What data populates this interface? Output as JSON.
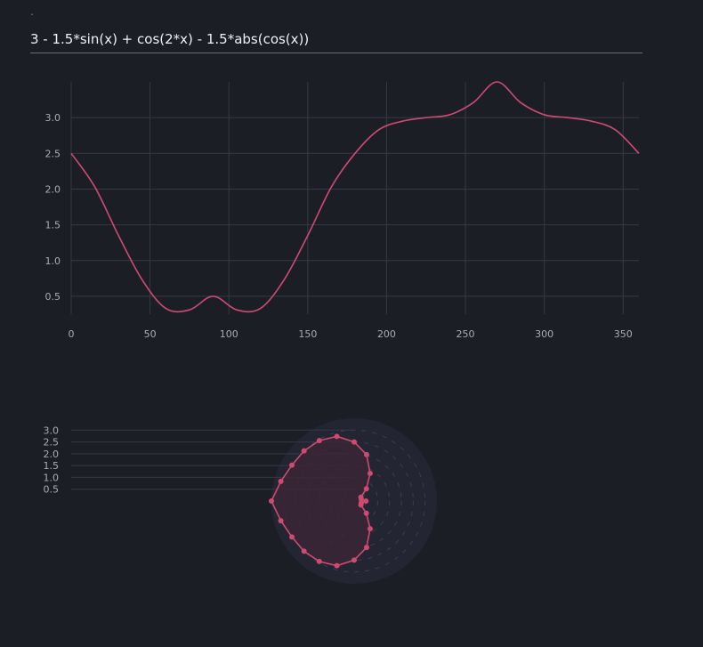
{
  "header": {
    "marker": "ˇ",
    "formula": "3 - 1.5*sin(x) + cos(2*x) - 1.5*abs(cos(x))"
  },
  "colors": {
    "background": "#1c1e26",
    "grid": "#353847",
    "line": "#cf4a72",
    "polar_disc": "#232632",
    "polar_fill": "#3a2636",
    "tick_text": "#a9acb8"
  },
  "chart_data": [
    {
      "type": "line",
      "title": "",
      "xlabel": "",
      "ylabel": "",
      "xlim": [
        0,
        360
      ],
      "ylim": [
        0.25,
        3.5
      ],
      "x_ticks": [
        "0",
        "50",
        "100",
        "150",
        "200",
        "250",
        "300",
        "350"
      ],
      "y_ticks": [
        "0.5",
        "1.0",
        "1.5",
        "2.0",
        "2.5",
        "3.0"
      ],
      "grid": true,
      "series": [
        {
          "x": [
            0,
            15,
            30,
            45,
            60,
            75,
            90,
            105,
            120,
            135,
            150,
            165,
            180,
            195,
            210,
            225,
            240,
            255,
            270,
            285,
            300,
            315,
            330,
            345,
            360
          ],
          "y": [
            2.5,
            2.03,
            1.35,
            0.73,
            0.33,
            0.31,
            0.5,
            0.31,
            0.33,
            0.73,
            1.35,
            2.03,
            2.5,
            2.83,
            2.95,
            3.0,
            3.04,
            3.21,
            3.5,
            3.21,
            3.04,
            3.0,
            2.95,
            2.83,
            2.5
          ]
        }
      ]
    },
    {
      "type": "polar",
      "title": "",
      "r_ticks": [
        "0.5",
        "1.0",
        "1.5",
        "2.0",
        "2.5",
        "3.0"
      ],
      "rlim": [
        0,
        3.5
      ],
      "grid": true,
      "series": [
        {
          "theta_deg": [
            0,
            15,
            30,
            45,
            60,
            75,
            90,
            105,
            120,
            135,
            150,
            165,
            180,
            195,
            210,
            225,
            240,
            255,
            270,
            285,
            300,
            315,
            330,
            345,
            360
          ],
          "r": [
            2.5,
            2.03,
            1.35,
            0.73,
            0.33,
            0.31,
            0.5,
            0.31,
            0.33,
            0.73,
            1.35,
            2.03,
            2.5,
            2.83,
            2.95,
            3.0,
            3.04,
            3.21,
            3.5,
            3.21,
            3.04,
            3.0,
            2.95,
            2.83,
            2.5
          ]
        }
      ]
    }
  ]
}
